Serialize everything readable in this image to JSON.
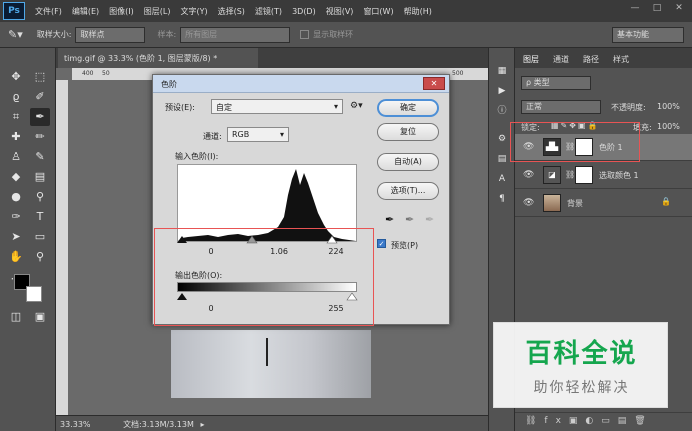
{
  "app": {
    "logo": "Ps"
  },
  "menu": [
    "文件(F)",
    "编辑(E)",
    "图像(I)",
    "图层(L)",
    "文字(Y)",
    "选择(S)",
    "滤镜(T)",
    "3D(D)",
    "视图(V)",
    "窗口(W)",
    "帮助(H)"
  ],
  "window_controls": {
    "minimize": "—",
    "restore": "□",
    "close": "✕"
  },
  "options": {
    "sample_size_label": "取样大小:",
    "sample_size_value": "取样点",
    "sample_label": "样本:",
    "sample_value": "所有图层",
    "show_ring": "显示取样环",
    "workspace": "基本功能"
  },
  "document": {
    "tab_title": "timg.gif @ 33.3% (色阶 1, 图层蒙版/8) *",
    "ruler_ticks": [
      "400",
      "50",
      "500"
    ],
    "zoom": "33.33%",
    "doc_size": "文档:3.13M/3.13M"
  },
  "levels_dialog": {
    "title": "色阶",
    "preset_label": "预设(E):",
    "preset_value": "自定",
    "channel_label": "通道:",
    "channel_value": "RGB",
    "input_label": "输入色阶(I):",
    "input_black": "0",
    "input_gamma": "1.06",
    "input_white": "224",
    "output_label": "输出色阶(O):",
    "output_black": "0",
    "output_white": "255",
    "buttons": {
      "ok": "确定",
      "reset": "复位",
      "auto": "自动(A)",
      "options": "选项(T)..."
    },
    "preview_label": "预览(P)",
    "preview_checked": true
  },
  "layers_panel": {
    "tabs": [
      "图层",
      "通道",
      "路径",
      "样式"
    ],
    "filter_value": "ρ 类型",
    "blend_mode": "正常",
    "opacity_label": "不透明度:",
    "opacity_value": "100%",
    "lock_label": "锁定:",
    "fill_label": "填充:",
    "fill_value": "100%",
    "layers": [
      {
        "name": "色阶 1",
        "active": true
      },
      {
        "name": "选取颜色 1",
        "active": false
      },
      {
        "name": "背景",
        "active": false
      }
    ]
  },
  "watermark": {
    "title": "百科全说",
    "subtitle": "助你轻松解决"
  },
  "colors": {
    "watermark_green": "#15a64e",
    "highlight_red": "#e85454"
  }
}
